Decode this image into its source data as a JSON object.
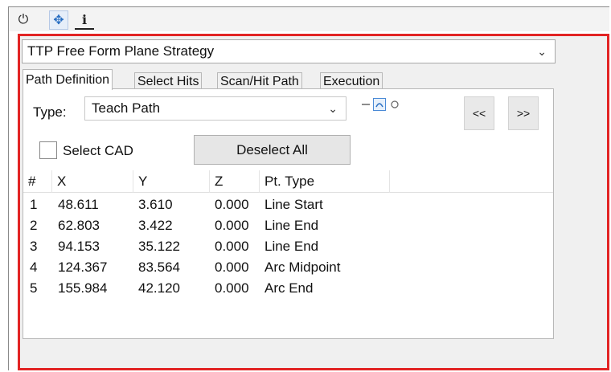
{
  "toolbar": {
    "icons": [
      "power-icon",
      "move-icon",
      "info-icon"
    ],
    "power_glyph": "⏻",
    "move_glyph": "✥",
    "info_glyph": "i"
  },
  "strategy": {
    "selected": "TTP Free Form Plane Strategy"
  },
  "tabs": [
    {
      "label": "Path Definition",
      "active": true
    },
    {
      "label": "Select Hits",
      "active": false
    },
    {
      "label": "Scan/Hit Path",
      "active": false
    },
    {
      "label": "Execution",
      "active": false
    }
  ],
  "path_definition": {
    "type_label": "Type:",
    "type_value": "Teach Path",
    "mode_icons": [
      "line-mode-icon",
      "arc-mode-icon",
      "circle-mode-icon"
    ],
    "prev_label": "<<",
    "next_label": ">>",
    "select_cad_label": "Select CAD",
    "select_cad_checked": false,
    "deselect_all_label": "Deselect All"
  },
  "points_table": {
    "columns": [
      "#",
      "X",
      "Y",
      "Z",
      "Pt. Type"
    ],
    "rows": [
      {
        "num": "1",
        "x": "48.611",
        "y": "3.610",
        "z": "0.000",
        "type": "Line Start"
      },
      {
        "num": "2",
        "x": "62.803",
        "y": "3.422",
        "z": "0.000",
        "type": "Line End"
      },
      {
        "num": "3",
        "x": "94.153",
        "y": "35.122",
        "z": "0.000",
        "type": "Line End"
      },
      {
        "num": "4",
        "x": "124.367",
        "y": "83.564",
        "z": "0.000",
        "type": "Arc Midpoint"
      },
      {
        "num": "5",
        "x": "155.984",
        "y": "42.120",
        "z": "0.000",
        "type": "Arc End"
      }
    ]
  },
  "colors": {
    "highlight_border": "#e22424",
    "accent_blue": "#2a6fc2"
  }
}
